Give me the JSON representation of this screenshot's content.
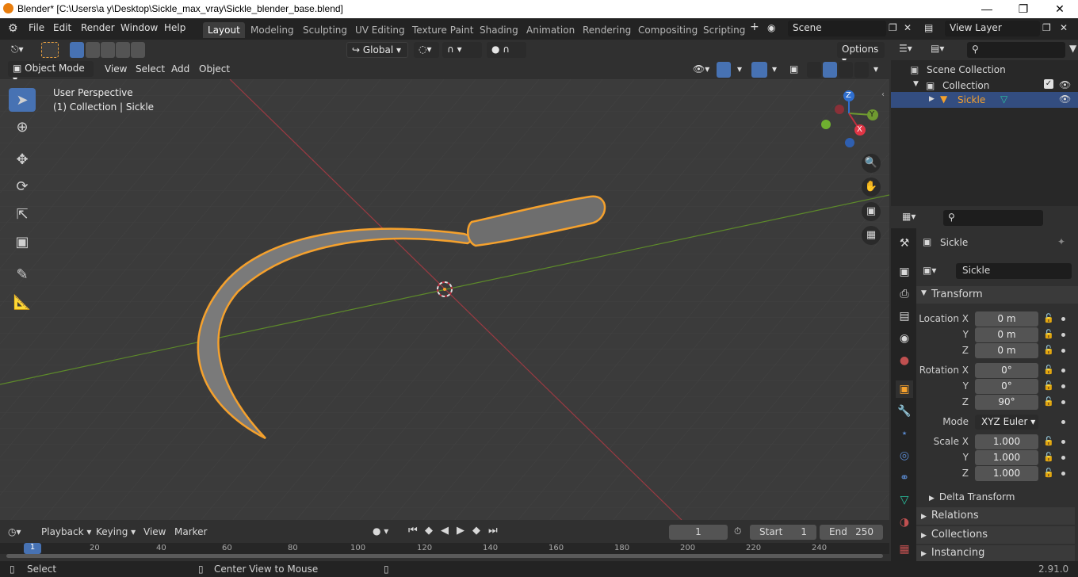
{
  "titlebar": {
    "title": "Blender* [C:\\Users\\a y\\Desktop\\Sickle_max_vray\\Sickle_blender_base.blend]"
  },
  "menus": [
    "File",
    "Edit",
    "Render",
    "Window",
    "Help"
  ],
  "workspaces": [
    "Layout",
    "Modeling",
    "Sculpting",
    "UV Editing",
    "Texture Paint",
    "Shading",
    "Animation",
    "Rendering",
    "Compositing",
    "Scripting"
  ],
  "scene": {
    "name": "Scene",
    "view_layer": "View Layer"
  },
  "header": {
    "orientation": "Global",
    "options": "Options"
  },
  "viewport_header": {
    "mode": "Object Mode",
    "menus": [
      "View",
      "Select",
      "Add",
      "Object"
    ]
  },
  "viewport": {
    "perspective": "User Perspective",
    "context": "(1) Collection | Sickle"
  },
  "gizmo": {
    "z": "Z",
    "y": "Y",
    "x": "X"
  },
  "outliner": {
    "scene_collection": "Scene Collection",
    "collection": "Collection",
    "object": "Sickle"
  },
  "properties": {
    "object_name": "Sickle",
    "data_name": "Sickle",
    "transform_label": "Transform",
    "location_label": "Location X",
    "rotation_label": "Rotation X",
    "scale_label": "Scale X",
    "y": "Y",
    "z": "Z",
    "location": [
      "0 m",
      "0 m",
      "0 m"
    ],
    "rotation": [
      "0°",
      "0°",
      "90°"
    ],
    "mode_label": "Mode",
    "mode": "XYZ Euler",
    "scale": [
      "1.000",
      "1.000",
      "1.000"
    ],
    "delta": "Delta Transform",
    "sections": [
      "Relations",
      "Collections",
      "Instancing"
    ]
  },
  "timeline": {
    "menus": [
      "Playback",
      "Keying",
      "View",
      "Marker"
    ],
    "current_frame": "1",
    "start_label": "Start",
    "start": "1",
    "end_label": "End",
    "end": "250",
    "ruler": [
      "20",
      "40",
      "60",
      "80",
      "100",
      "120",
      "140",
      "160",
      "180",
      "200",
      "220",
      "240"
    ],
    "ruler_active": "1"
  },
  "statusbar": {
    "select": "Select",
    "center": "Center View to Mouse",
    "version": "2.91.0"
  },
  "colors": {
    "accent": "#4772b3",
    "selection": "#f5a12d",
    "x_axis": "#c03040",
    "y_axis": "#6f9a30"
  }
}
